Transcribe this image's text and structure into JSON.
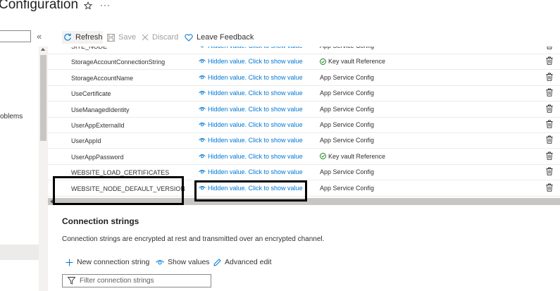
{
  "header": {
    "title": "Configuration",
    "more": "···"
  },
  "left_nav": {
    "collapse": "«",
    "problems_fragment": "oblems"
  },
  "toolbar": {
    "refresh": "Refresh",
    "save": "Save",
    "discard": "Discard",
    "feedback": "Leave Feedback"
  },
  "settings": {
    "rows": [
      {
        "name": "SITE_NODE",
        "value": "Hidden value. Click to show value",
        "source": "App Service Config",
        "keyvault": false
      },
      {
        "name": "StorageAccountConnectionString",
        "value": "Hidden value. Click to show value",
        "source": "Key vault Reference",
        "keyvault": true
      },
      {
        "name": "StorageAccountName",
        "value": "Hidden value. Click to show value",
        "source": "App Service Config",
        "keyvault": false
      },
      {
        "name": "UseCertificate",
        "value": "Hidden value. Click to show value",
        "source": "App Service Config",
        "keyvault": false
      },
      {
        "name": "UseManagedIdentity",
        "value": "Hidden value. Click to show value",
        "source": "App Service Config",
        "keyvault": false
      },
      {
        "name": "UserAppExternalId",
        "value": "Hidden value. Click to show value",
        "source": "App Service Config",
        "keyvault": false
      },
      {
        "name": "UserAppId",
        "value": "Hidden value. Click to show value",
        "source": "App Service Config",
        "keyvault": false
      },
      {
        "name": "UserAppPassword",
        "value": "Hidden value. Click to show value",
        "source": "Key vault Reference",
        "keyvault": true
      },
      {
        "name": "WEBSITE_LOAD_CERTIFICATES",
        "value": "Hidden value. Click to show value",
        "source": "App Service Config",
        "keyvault": false
      },
      {
        "name": "WEBSITE_NODE_DEFAULT_VERSION",
        "value": "Hidden value. Click to show value",
        "source": "App Service Config",
        "keyvault": false
      }
    ]
  },
  "connection_strings": {
    "title": "Connection strings",
    "description": "Connection strings are encrypted at rest and transmitted over an encrypted channel.",
    "new_label": "New connection string",
    "show_label": "Show values",
    "advanced_label": "Advanced edit",
    "filter_placeholder": "Filter connection strings"
  },
  "colors": {
    "accent": "#0078d4",
    "success": "#107c10",
    "annotation": "#000000"
  }
}
